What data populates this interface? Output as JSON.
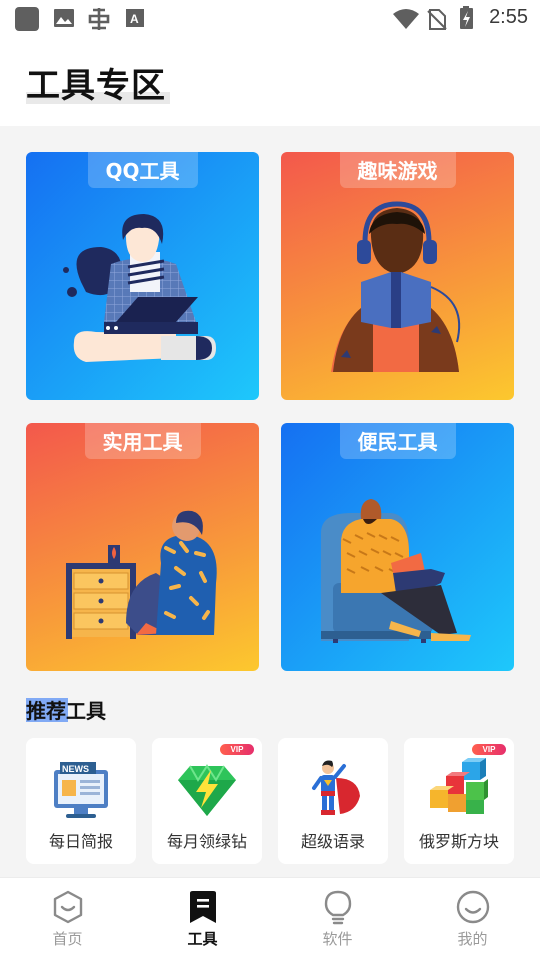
{
  "status_bar": {
    "time": "2:55",
    "left_icons": [
      "app-square-icon",
      "gallery-icon",
      "bug-app-icon",
      "text-a-icon"
    ],
    "right_icons": [
      "wifi-icon",
      "no-sim-icon",
      "battery-charging-icon"
    ]
  },
  "header": {
    "title": "工具专区"
  },
  "categories": [
    {
      "label": "QQ工具",
      "theme": "blue",
      "illustration": "person-laptop-illustration"
    },
    {
      "label": "趣味游戏",
      "theme": "orange",
      "illustration": "person-headphones-illustration"
    },
    {
      "label": "实用工具",
      "theme": "orange",
      "illustration": "person-sitting-floor-illustration"
    },
    {
      "label": "便民工具",
      "theme": "blue",
      "illustration": "person-armchair-reading-illustration"
    }
  ],
  "recommend": {
    "title": "推荐工具",
    "items": [
      {
        "label": "每日简报",
        "icon": "news-monitor-icon",
        "vip": false
      },
      {
        "label": "每月领绿钻",
        "icon": "green-diamond-icon",
        "vip": true,
        "badge": "VIP"
      },
      {
        "label": "超级语录",
        "icon": "superhero-icon",
        "vip": false
      },
      {
        "label": "俄罗斯方块",
        "icon": "tetris-cubes-icon",
        "vip": true,
        "badge": "VIP"
      }
    ]
  },
  "nav": {
    "items": [
      {
        "label": "首页",
        "icon": "home-hexagon-icon",
        "active": false
      },
      {
        "label": "工具",
        "icon": "tools-bookmark-icon",
        "active": true
      },
      {
        "label": "软件",
        "icon": "lightbulb-icon",
        "active": false
      },
      {
        "label": "我的",
        "icon": "smile-face-icon",
        "active": false
      }
    ]
  },
  "colors": {
    "card_blue_start": "#1570f2",
    "card_blue_end": "#1ec8fb",
    "card_orange_start": "#f3584c",
    "card_orange_end": "#fcc82e",
    "nav_active": "#111111",
    "nav_inactive": "#9a9a9a"
  }
}
